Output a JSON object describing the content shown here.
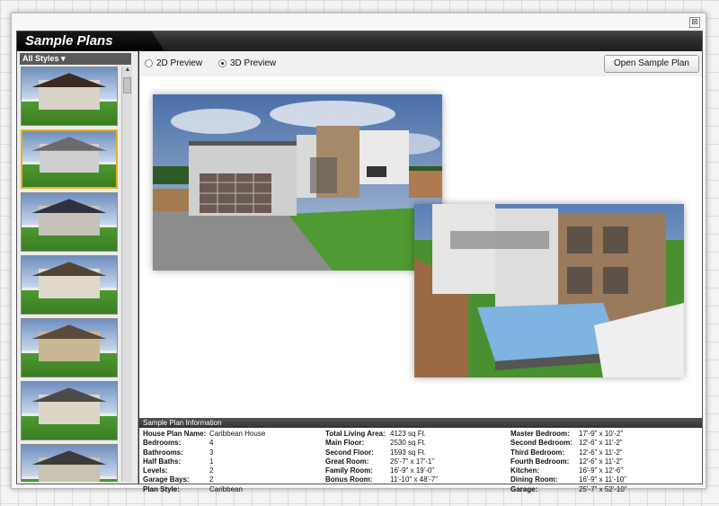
{
  "window": {
    "title": "Sample Plans",
    "close_glyph": "⊠"
  },
  "sidebar": {
    "dropdown_label": "All Styles",
    "thumbnails": [
      {
        "roof": "#3a2a20",
        "wall": "#d8d2c8"
      },
      {
        "roof": "#6b6b6b",
        "wall": "#cfcfcf"
      },
      {
        "roof": "#2f3140",
        "wall": "#c7c2b8"
      },
      {
        "roof": "#514434",
        "wall": "#e0d8c8"
      },
      {
        "roof": "#5a4a3a",
        "wall": "#cbb693"
      },
      {
        "roof": "#4b4b4b",
        "wall": "#ddd6c6"
      },
      {
        "roof": "#3b3b3b",
        "wall": "#c9c3b3"
      }
    ]
  },
  "toolbar": {
    "preview_2d": "2D Preview",
    "preview_3d": "3D Preview",
    "open_button": "Open Sample Plan"
  },
  "info": {
    "header": "Sample Plan Information",
    "col1": [
      {
        "label": "House Plan Name:",
        "value": "Caribbean House"
      },
      {
        "label": "Bedrooms:",
        "value": "4"
      },
      {
        "label": "Bathrooms:",
        "value": "3"
      },
      {
        "label": "Half Baths:",
        "value": "1"
      },
      {
        "label": "Levels:",
        "value": "2"
      },
      {
        "label": "Garage Bays:",
        "value": "2"
      },
      {
        "label": "Plan Style:",
        "value": "Caribbean"
      }
    ],
    "col2": [
      {
        "label": "Total Living Area:",
        "value": "4123 sq Ft."
      },
      {
        "label": "Main Floor:",
        "value": "2530 sq Ft."
      },
      {
        "label": "Second Floor:",
        "value": "1593 sq Ft."
      },
      {
        "label": "Great Room:",
        "value": "25'-7\" x 17'-1\""
      },
      {
        "label": "Family Room:",
        "value": "16'-9\" x 19'-0\""
      },
      {
        "label": "Bonus Room:",
        "value": "11'-10\" x 48'-7\""
      }
    ],
    "col3": [
      {
        "label": "Master Bedroom:",
        "value": "17'-9\" x 10'-2\""
      },
      {
        "label": "Second Bedroom:",
        "value": "12'-6\" x 11'-2\""
      },
      {
        "label": "Third Bedroom:",
        "value": "12'-6\" x 11'-2\""
      },
      {
        "label": "Fourth Bedroom:",
        "value": "12'-6\" x 11'-2\""
      },
      {
        "label": "Kitchen:",
        "value": "16'-9\" x 12'-6\""
      },
      {
        "label": "Dining Room:",
        "value": "16'-9\" x 11'-10\""
      },
      {
        "label": "Garage:",
        "value": "25'-7\" x 52'-10\""
      }
    ]
  }
}
